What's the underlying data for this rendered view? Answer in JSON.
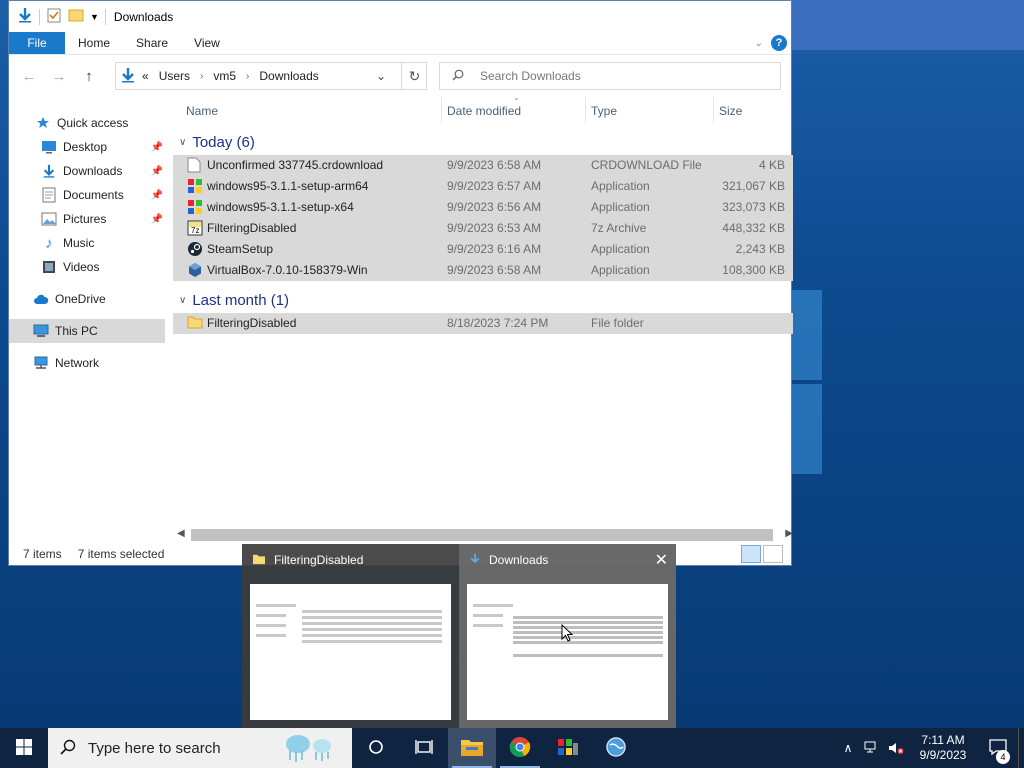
{
  "window": {
    "title": "Downloads",
    "ribbon_tabs": [
      "File",
      "Home",
      "Share",
      "View"
    ],
    "help_label": "?"
  },
  "address": {
    "prefix": "«",
    "crumbs": [
      "Users",
      "vm5",
      "Downloads"
    ]
  },
  "search": {
    "placeholder": "Search Downloads"
  },
  "sidebar": {
    "items": [
      {
        "label": "Quick access",
        "icon": "star-icon"
      },
      {
        "label": "Desktop",
        "icon": "desktop-icon",
        "pinned": true
      },
      {
        "label": "Downloads",
        "icon": "download-icon",
        "pinned": true
      },
      {
        "label": "Documents",
        "icon": "documents-icon",
        "pinned": true
      },
      {
        "label": "Pictures",
        "icon": "pictures-icon",
        "pinned": true
      },
      {
        "label": "Music",
        "icon": "music-icon"
      },
      {
        "label": "Videos",
        "icon": "videos-icon"
      },
      {
        "label": "OneDrive",
        "icon": "cloud-icon"
      },
      {
        "label": "This PC",
        "icon": "computer-icon"
      },
      {
        "label": "Network",
        "icon": "network-icon"
      }
    ]
  },
  "columns": {
    "name": "Name",
    "date": "Date modified",
    "type": "Type",
    "size": "Size"
  },
  "groups": [
    {
      "label": "Today (6)",
      "files": [
        {
          "name": "Unconfirmed 337745.crdownload",
          "date": "9/9/2023 6:58 AM",
          "type": "CRDOWNLOAD File",
          "size": "4 KB",
          "icon": "file-icon"
        },
        {
          "name": "windows95-3.1.1-setup-arm64",
          "date": "9/9/2023 6:57 AM",
          "type": "Application",
          "size": "321,067 KB",
          "icon": "windows-app-icon"
        },
        {
          "name": "windows95-3.1.1-setup-x64",
          "date": "9/9/2023 6:56 AM",
          "type": "Application",
          "size": "323,073 KB",
          "icon": "windows-app-icon"
        },
        {
          "name": "FilteringDisabled",
          "date": "9/9/2023 6:53 AM",
          "type": "7z Archive",
          "size": "448,332 KB",
          "icon": "archive-icon"
        },
        {
          "name": "SteamSetup",
          "date": "9/9/2023 6:16 AM",
          "type": "Application",
          "size": "2,243 KB",
          "icon": "steam-icon"
        },
        {
          "name": "VirtualBox-7.0.10-158379-Win",
          "date": "9/9/2023 6:58 AM",
          "type": "Application",
          "size": "108,300 KB",
          "icon": "virtualbox-icon"
        }
      ]
    },
    {
      "label": "Last month (1)",
      "files": [
        {
          "name": "FilteringDisabled",
          "date": "8/18/2023 7:24 PM",
          "type": "File folder",
          "size": "",
          "icon": "folder-icon"
        }
      ]
    }
  ],
  "status": {
    "count": "7 items",
    "selected": "7 items selected"
  },
  "thumbnails": [
    {
      "title": "FilteringDisabled",
      "icon": "folder-icon"
    },
    {
      "title": "Downloads",
      "icon": "download-icon"
    }
  ],
  "taskbar": {
    "search_placeholder": "Type here to search",
    "time": "7:11 AM",
    "date": "9/9/2023",
    "notification_count": "4"
  },
  "colors": {
    "accent": "#1979ca",
    "selection": "#d9d9d9",
    "taskbar": "#0f2440"
  }
}
